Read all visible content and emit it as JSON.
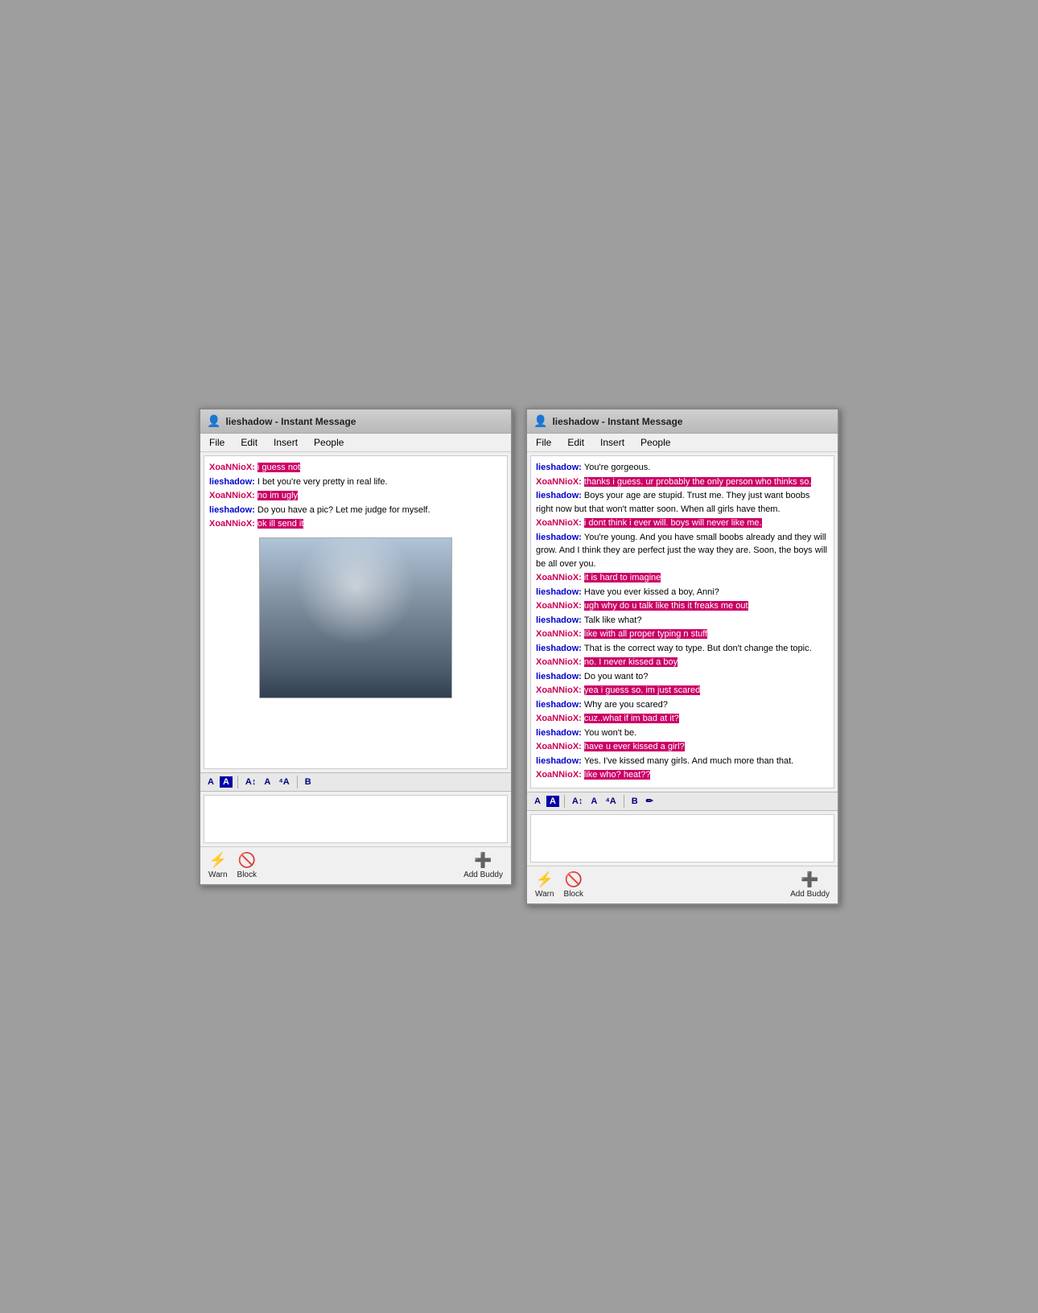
{
  "window1": {
    "title": "lieshadow - Instant Message",
    "menu": [
      "File",
      "Edit",
      "Insert",
      "People"
    ],
    "chat": [
      {
        "user": "XoaNNioX",
        "user_type": "red",
        "message": "i guess not",
        "highlight": true
      },
      {
        "user": "lieshadow",
        "user_type": "blue",
        "message": "I bet you're very pretty in real life.",
        "highlight": false
      },
      {
        "user": "XoaNNioX",
        "user_type": "red",
        "message": "no im ugly",
        "highlight": true
      },
      {
        "user": "lieshadow",
        "user_type": "blue",
        "message": "Do you have a pic? Let me judge for myself.",
        "highlight": false
      },
      {
        "user": "XoaNNioX",
        "user_type": "red",
        "message": "ok ill send it",
        "highlight": true
      }
    ],
    "has_image": true,
    "toolbar": {
      "btns": [
        "A",
        "A",
        "A↕",
        "A",
        "⁴A",
        "B"
      ]
    },
    "bottom_btns": {
      "warn": "Warn",
      "block": "Block",
      "add_buddy": "Add Buddy"
    }
  },
  "window2": {
    "title": "lieshadow - Instant Message",
    "menu": [
      "File",
      "Edit",
      "Insert",
      "People"
    ],
    "chat": [
      {
        "user": "lieshadow",
        "user_type": "blue",
        "message": "You're gorgeous.",
        "highlight": false
      },
      {
        "user": "XoaNNioX",
        "user_type": "red",
        "message": "thanks i guess. ur probably the only person who thinks so.",
        "highlight": true
      },
      {
        "user": "lieshadow",
        "user_type": "blue",
        "message": "Boys your age are stupid. Trust me. They just want boobs right now but that won't matter soon. When all girls have them.",
        "highlight": false
      },
      {
        "user": "XoaNNioX",
        "user_type": "red",
        "message": "i dont think i ever will. boys will never like me.",
        "highlight": true
      },
      {
        "user": "lieshadow",
        "user_type": "blue",
        "message": "You're young. And you have small boobs already and they will grow. And I think they are perfect just the way they are. Soon, the boys will be all over you.",
        "highlight": false
      },
      {
        "user": "XoaNNioX",
        "user_type": "red",
        "message": "it is hard to imagine",
        "highlight": true
      },
      {
        "user": "lieshadow",
        "user_type": "blue",
        "message": "Have you ever kissed a boy, Anni?",
        "highlight": false
      },
      {
        "user": "XoaNNioX",
        "user_type": "red",
        "message": "ugh why do u talk like this it freaks me out",
        "highlight": true
      },
      {
        "user": "lieshadow",
        "user_type": "blue",
        "message": "Talk like what?",
        "highlight": false
      },
      {
        "user": "XoaNNioX",
        "user_type": "red",
        "message": "like with all proper typing n stuff",
        "highlight": true
      },
      {
        "user": "lieshadow",
        "user_type": "blue",
        "message": "That is the correct way to type. But don't change the topic.",
        "highlight": false
      },
      {
        "user": "XoaNNioX",
        "user_type": "red",
        "message": "no. I never kissed a boy",
        "highlight": true
      },
      {
        "user": "lieshadow",
        "user_type": "blue",
        "message": "Do you want to?",
        "highlight": false
      },
      {
        "user": "XoaNNioX",
        "user_type": "red",
        "message": "yea i guess so. im just scared",
        "highlight": true
      },
      {
        "user": "lieshadow",
        "user_type": "blue",
        "message": "Why are you scared?",
        "highlight": false
      },
      {
        "user": "XoaNNioX",
        "user_type": "red",
        "message": "cuz..what if im bad at it?",
        "highlight": true
      },
      {
        "user": "lieshadow",
        "user_type": "blue",
        "message": "You won't be.",
        "highlight": false
      },
      {
        "user": "XoaNNioX",
        "user_type": "red",
        "message": "have u ever kissed a girl?",
        "highlight": true
      },
      {
        "user": "lieshadow",
        "user_type": "blue",
        "message": "Yes. I've kissed many girls. And much more than that.",
        "highlight": false
      },
      {
        "user": "XoaNNioX",
        "user_type": "red",
        "message": "like who? heat??",
        "highlight": true
      }
    ],
    "toolbar": {
      "btns": [
        "A",
        "A",
        "A↕",
        "A",
        "⁴A",
        "B",
        "✏"
      ]
    },
    "bottom_btns": {
      "warn": "Warn",
      "block": "Block",
      "add_buddy": "Add Buddy"
    }
  },
  "icons": {
    "person": "👤",
    "warn": "⚡",
    "block": "🚫",
    "add_buddy": "➕",
    "pencil": "✏"
  }
}
